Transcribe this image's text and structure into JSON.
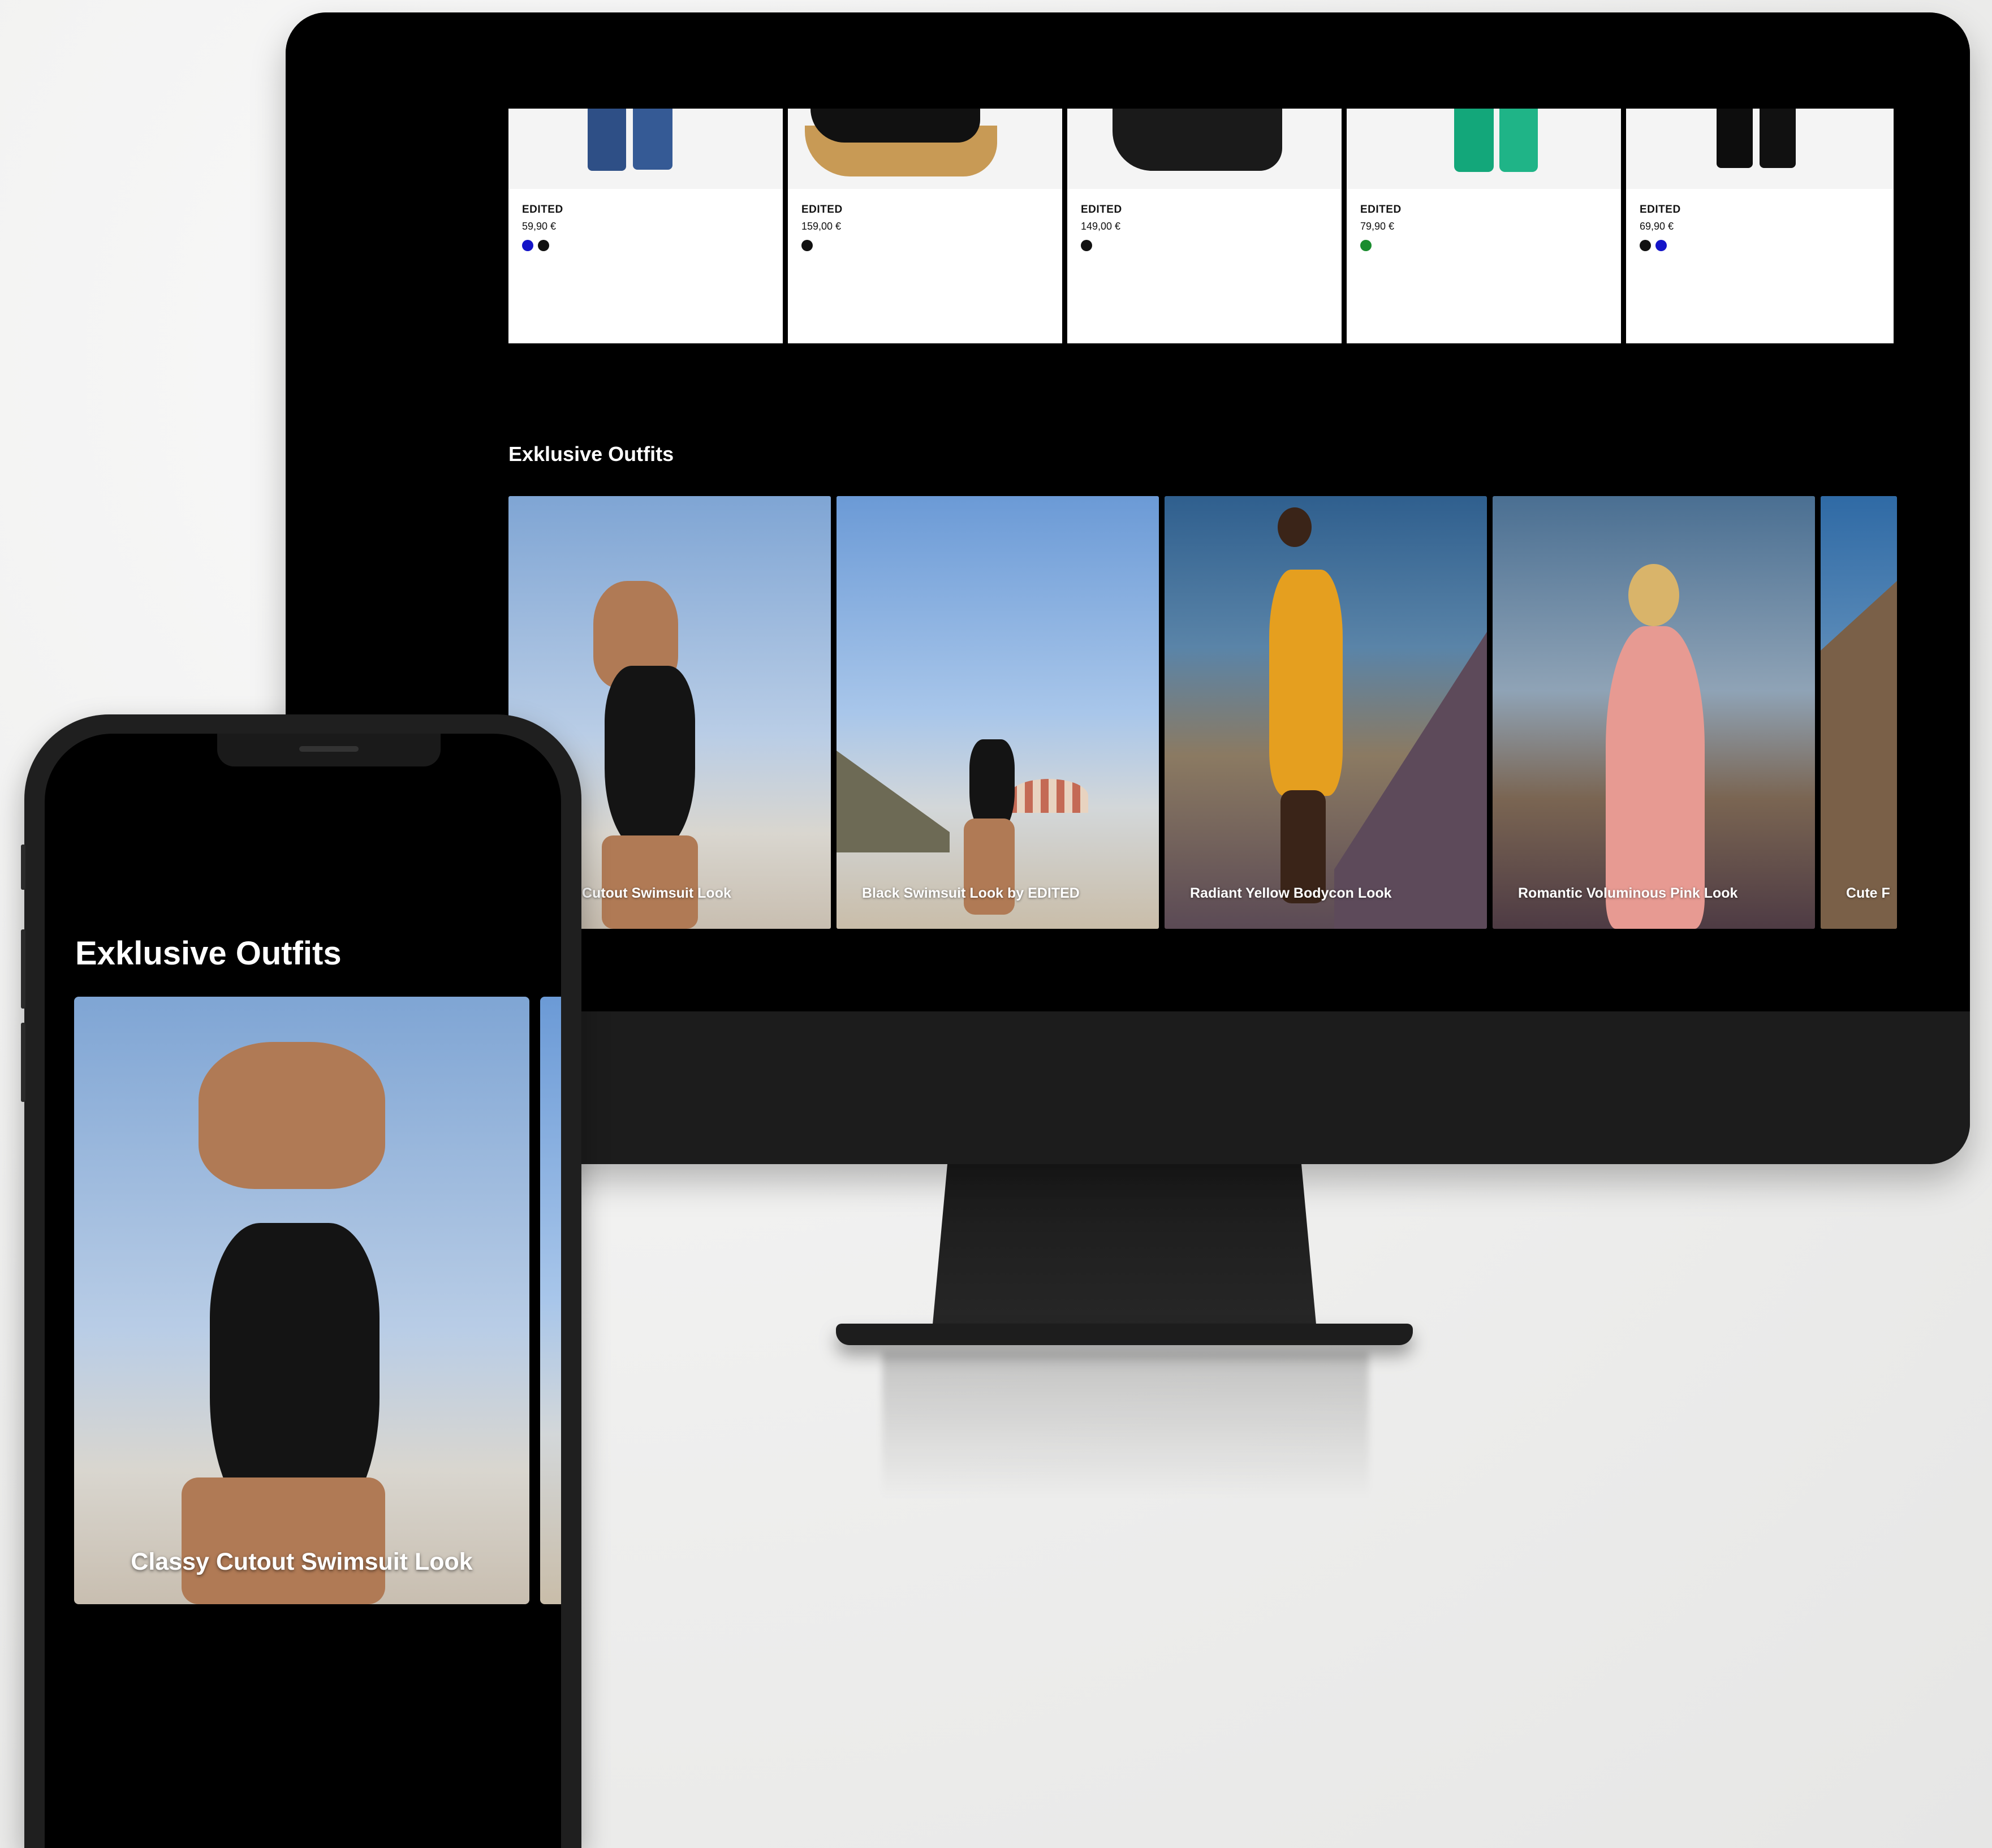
{
  "desktop": {
    "products": [
      {
        "brand": "EDITED",
        "price": "59,90 €",
        "swatches": [
          "#1414c8",
          "#111111"
        ]
      },
      {
        "brand": "EDITED",
        "price": "159,00 €",
        "swatches": [
          "#111111"
        ]
      },
      {
        "brand": "EDITED",
        "price": "149,00 €",
        "swatches": [
          "#111111"
        ]
      },
      {
        "brand": "EDITED",
        "price": "79,90 €",
        "swatches": [
          "#1a8c2e"
        ]
      },
      {
        "brand": "EDITED",
        "price": "69,90 €",
        "swatches": [
          "#111111",
          "#1414c8"
        ]
      }
    ],
    "section_title": "Exklusive Outfits",
    "outfits": [
      {
        "label": "Cutout Swimsuit Look"
      },
      {
        "label": "Black Swimsuit Look by EDITED"
      },
      {
        "label": "Radiant Yellow Bodycon Look"
      },
      {
        "label": "Romantic Voluminous Pink Look"
      },
      {
        "label": "Cute F"
      }
    ]
  },
  "mobile": {
    "section_title": "Exklusive Outfits",
    "outfit_label": "Classy Cutout Swimsuit Look"
  }
}
